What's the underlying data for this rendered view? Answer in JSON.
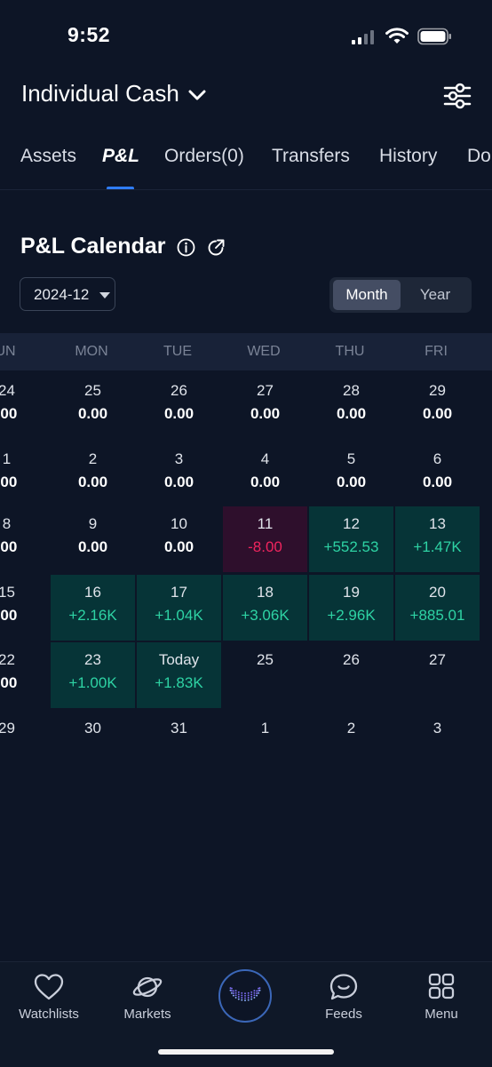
{
  "status_bar": {
    "time": "9:52"
  },
  "header": {
    "account_name": "Individual Cash"
  },
  "tabs": [
    {
      "label": "Assets"
    },
    {
      "label": "P&L"
    },
    {
      "label": "Orders(0)"
    },
    {
      "label": "Transfers"
    },
    {
      "label": "History"
    },
    {
      "label": "Do"
    }
  ],
  "calendar": {
    "title": "P&L Calendar",
    "month_value": "2024-12",
    "view_toggle": {
      "month": "Month",
      "year": "Year",
      "selected": "Month"
    },
    "weekdays": [
      "UN",
      "MON",
      "TUE",
      "WED",
      "THU",
      "FRI"
    ],
    "weeks": [
      [
        {
          "day": "24",
          "value": ".00"
        },
        {
          "day": "25",
          "value": "0.00"
        },
        {
          "day": "26",
          "value": "0.00"
        },
        {
          "day": "27",
          "value": "0.00"
        },
        {
          "day": "28",
          "value": "0.00"
        },
        {
          "day": "29",
          "value": "0.00"
        }
      ],
      [
        {
          "day": "1",
          "value": ".00"
        },
        {
          "day": "2",
          "value": "0.00"
        },
        {
          "day": "3",
          "value": "0.00"
        },
        {
          "day": "4",
          "value": "0.00"
        },
        {
          "day": "5",
          "value": "0.00"
        },
        {
          "day": "6",
          "value": "0.00"
        }
      ],
      [
        {
          "day": "8",
          "value": ".00"
        },
        {
          "day": "9",
          "value": "0.00"
        },
        {
          "day": "10",
          "value": "0.00"
        },
        {
          "day": "11",
          "value": "-8.00",
          "tone": "neg"
        },
        {
          "day": "12",
          "value": "+552.53",
          "tone": "pos"
        },
        {
          "day": "13",
          "value": "+1.47K",
          "tone": "pos"
        }
      ],
      [
        {
          "day": "15",
          "value": ".00"
        },
        {
          "day": "16",
          "value": "+2.16K",
          "tone": "pos"
        },
        {
          "day": "17",
          "value": "+1.04K",
          "tone": "pos"
        },
        {
          "day": "18",
          "value": "+3.06K",
          "tone": "pos"
        },
        {
          "day": "19",
          "value": "+2.96K",
          "tone": "pos"
        },
        {
          "day": "20",
          "value": "+885.01",
          "tone": "pos"
        }
      ],
      [
        {
          "day": "22",
          "value": ".00"
        },
        {
          "day": "23",
          "value": "+1.00K",
          "tone": "pos"
        },
        {
          "day": "Today",
          "value": "+1.83K",
          "tone": "pos"
        },
        {
          "day": "25",
          "value": ""
        },
        {
          "day": "26",
          "value": ""
        },
        {
          "day": "27",
          "value": ""
        }
      ],
      [
        {
          "day": "29",
          "value": ""
        },
        {
          "day": "30",
          "value": ""
        },
        {
          "day": "31",
          "value": ""
        },
        {
          "day": "1",
          "value": ""
        },
        {
          "day": "2",
          "value": ""
        },
        {
          "day": "3",
          "value": ""
        }
      ]
    ]
  },
  "bottom_nav": [
    {
      "label": "Watchlists",
      "icon": "heart-icon"
    },
    {
      "label": "Markets",
      "icon": "planet-icon"
    },
    {
      "label": "",
      "icon": "smile-logo-icon"
    },
    {
      "label": "Feeds",
      "icon": "chat-bubble-icon"
    },
    {
      "label": "Menu",
      "icon": "grid-icon"
    }
  ],
  "colors": {
    "background": "#0d1526",
    "accent": "#2f7cf6",
    "positive": "#2ed3a4",
    "negative": "#f0245e",
    "positive_cell": "#063437",
    "negative_cell": "#2e0f2c"
  }
}
